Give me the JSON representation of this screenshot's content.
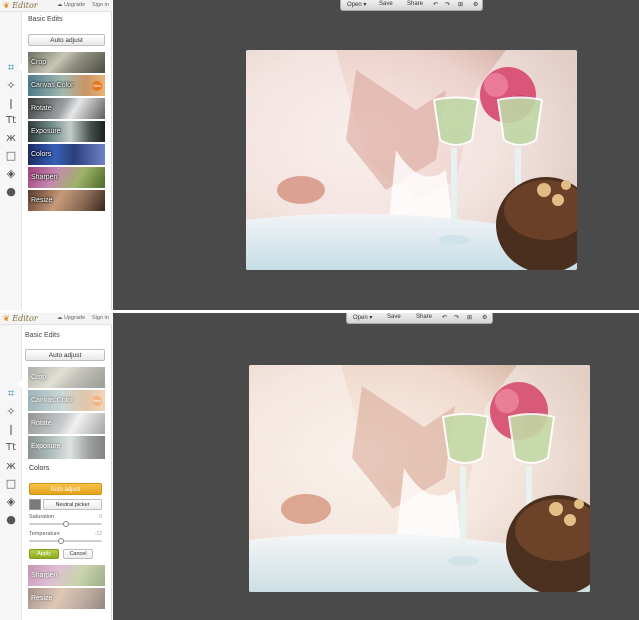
{
  "header": {
    "logo_text": "Editor",
    "links": [
      "Upgrade",
      "Sign in"
    ]
  },
  "sidebar": {
    "title": "Basic Edits",
    "auto_adjust_label": "Auto adjust",
    "tools": [
      {
        "label": "Crop"
      },
      {
        "label": "Canvas Color",
        "badge": "New"
      },
      {
        "label": "Rotate"
      },
      {
        "label": "Exposure"
      },
      {
        "label": "Colors"
      },
      {
        "label": "Sharpen"
      },
      {
        "label": "Resize"
      }
    ],
    "icons": [
      "crop-icon",
      "magic-wand-icon",
      "brush-icon",
      "text-icon",
      "butterfly-icon",
      "frame-icon",
      "texture-icon",
      "apple-icon"
    ]
  },
  "toolbar": {
    "open_label": "Open",
    "save_label": "Save",
    "share_label": "Share",
    "icons": [
      "undo-icon",
      "redo-icon",
      "zoom-icon",
      "gear-icon"
    ]
  },
  "colors_panel": {
    "title": "Colors",
    "auto_adjust_label": "Auto adjust",
    "neutral_picker_label": "Neutral picker",
    "saturation_label": "Saturation",
    "saturation_value": "0",
    "temperature_label": "Temperature",
    "temperature_value": "-12",
    "apply_label": "Apply",
    "cancel_label": "Cancel",
    "accent_color": "#e5a21f",
    "apply_color": "#8ead22"
  }
}
